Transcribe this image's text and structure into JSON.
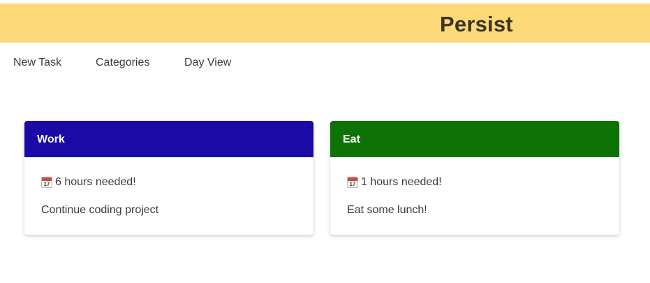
{
  "app": {
    "title": "Persist",
    "header_color": "#fdd97a"
  },
  "nav": {
    "items": [
      {
        "label": "New Task"
      },
      {
        "label": "Categories"
      },
      {
        "label": "Day View"
      }
    ]
  },
  "cards": [
    {
      "category": "Work",
      "header_color": "#1c0aa7",
      "calendar_icon": "calendar-icon",
      "hours_text": "6 hours needed!",
      "description": "Continue coding project"
    },
    {
      "category": "Eat",
      "header_color": "#0e7305",
      "calendar_icon": "calendar-icon",
      "hours_text": "1 hours needed!",
      "description": "Eat some lunch!"
    }
  ]
}
